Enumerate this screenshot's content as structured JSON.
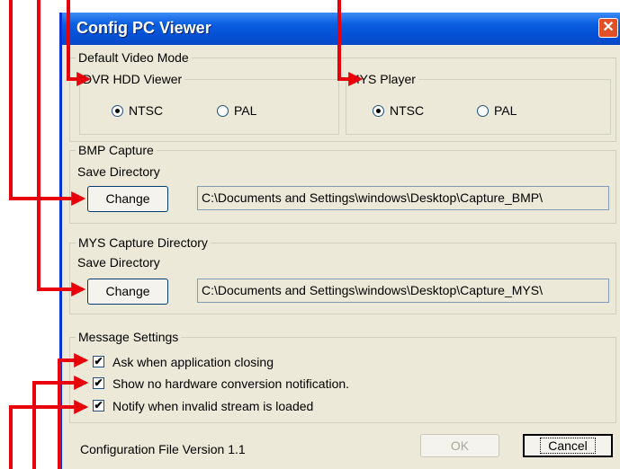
{
  "window": {
    "title": "Config PC Viewer",
    "close_glyph": "✕"
  },
  "default_video_mode": {
    "label": "Default Video Mode",
    "dvr_hdd_viewer": {
      "label": "DVR HDD Viewer",
      "ntsc": "NTSC",
      "pal": "PAL",
      "selected": "NTSC"
    },
    "mys_player": {
      "label": "MYS Player",
      "ntsc": "NTSC",
      "pal": "PAL",
      "selected": "NTSC"
    }
  },
  "bmp_capture": {
    "label": "BMP Capture",
    "save_directory_label": "Save Directory",
    "change_button": "Change",
    "path": "C:\\Documents and Settings\\windows\\Desktop\\Capture_BMP\\"
  },
  "mys_capture": {
    "label": "MYS Capture Directory",
    "save_directory_label": "Save Directory",
    "change_button": "Change",
    "path": "C:\\Documents and Settings\\windows\\Desktop\\Capture_MYS\\"
  },
  "message_settings": {
    "label": "Message Settings",
    "items": [
      {
        "label": "Ask when application closing",
        "checked": true
      },
      {
        "label": "Show no hardware conversion notification.",
        "checked": true
      },
      {
        "label": "Notify when invalid stream is loaded",
        "checked": true
      }
    ]
  },
  "footer": {
    "version_text": "Configuration File Version 1.1",
    "ok_button": "OK",
    "cancel_button": "Cancel"
  },
  "check_glyph": "✔",
  "annotation_color": "#e8000b"
}
